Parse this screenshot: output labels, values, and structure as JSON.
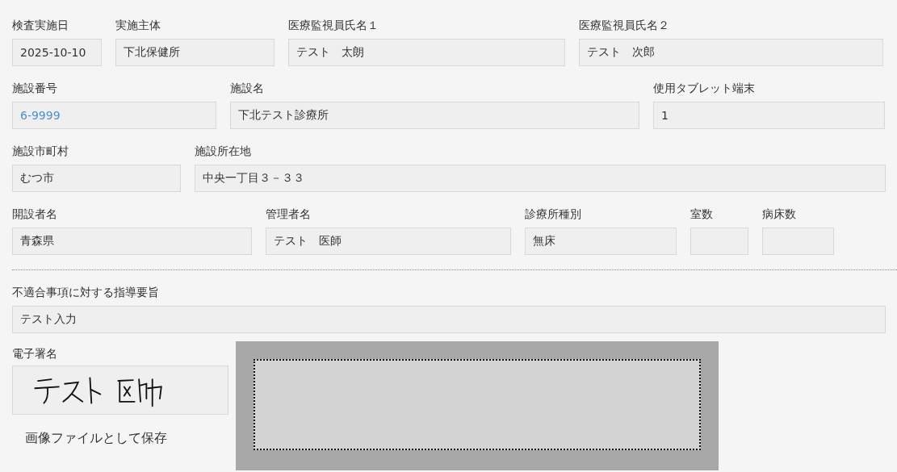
{
  "rows": [
    {
      "fields": [
        {
          "label": "検査実施日",
          "value": "2025-10-10",
          "kind": "text"
        },
        {
          "label": "実施主体",
          "value": "下北保健所",
          "kind": "text"
        },
        {
          "label": "医療監視員氏名１",
          "value": "テスト　太朗",
          "kind": "text"
        },
        {
          "label": "医療監視員氏名２",
          "value": "テスト　次郎",
          "kind": "text"
        }
      ]
    },
    {
      "fields": [
        {
          "label": "施設番号",
          "value": "6-9999",
          "kind": "link"
        },
        {
          "label": "施設名",
          "value": "下北テスト診療所",
          "kind": "text"
        },
        {
          "label": "使用タブレット端末",
          "value": "1",
          "kind": "text"
        }
      ]
    },
    {
      "fields": [
        {
          "label": "施設市町村",
          "value": "むつ市",
          "kind": "text"
        },
        {
          "label": "施設所在地",
          "value": "中央一丁目３－３３",
          "kind": "text"
        }
      ]
    },
    {
      "fields": [
        {
          "label": "開設者名",
          "value": "青森県",
          "kind": "text"
        },
        {
          "label": "管理者名",
          "value": "テスト　医師",
          "kind": "text"
        },
        {
          "label": "診療所種別",
          "value": "無床",
          "kind": "text"
        },
        {
          "label": "室数"
        },
        {
          "label": "病床数"
        }
      ]
    }
  ],
  "guidance": {
    "label": "不適合事項に対する指導要旨",
    "value": "テスト入力"
  },
  "signature": {
    "label": "電子署名",
    "save_button": "画像ファイルとして保存"
  }
}
